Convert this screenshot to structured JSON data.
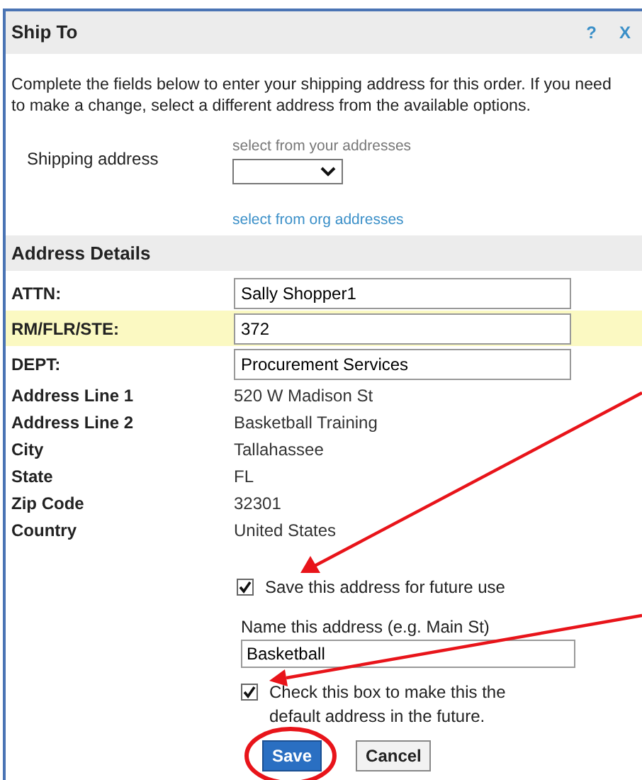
{
  "dialog": {
    "title": "Ship To",
    "help": "?",
    "close": "X"
  },
  "description": "Complete the fields below to enter your shipping address for this order. If you need to make a change, select a different address from the available options.",
  "shipping": {
    "label": "Shipping address",
    "hint": "select from your addresses",
    "link": "select from org addresses"
  },
  "section_title": "Address Details",
  "fields": [
    {
      "label": "ATTN:",
      "value": "Sally Shopper1",
      "kind": "input",
      "highlighted": false
    },
    {
      "label": "RM/FLR/STE:",
      "value": "372",
      "kind": "input",
      "highlighted": true
    },
    {
      "label": "DEPT:",
      "value": "Procurement Services",
      "kind": "input",
      "highlighted": false
    },
    {
      "label": "Address Line 1",
      "value": "520 W Madison St",
      "kind": "text"
    },
    {
      "label": "Address Line 2",
      "value": "Basketball Training",
      "kind": "text"
    },
    {
      "label": "City",
      "value": "Tallahassee",
      "kind": "text"
    },
    {
      "label": "State",
      "value": "FL",
      "kind": "text"
    },
    {
      "label": "Zip Code",
      "value": "32301",
      "kind": "text"
    },
    {
      "label": "Country",
      "value": "United States",
      "kind": "text"
    }
  ],
  "save_address": {
    "label": "Save this address for future use",
    "checked": true
  },
  "name_field": {
    "label": "Name this address (e.g. Main St)",
    "value": "Basketball"
  },
  "default_address": {
    "label": "Check this box to make this the default address in the future.",
    "checked": true
  },
  "buttons": [
    {
      "label": "Save",
      "kind": "primary"
    },
    {
      "label": "Cancel",
      "kind": "secondary"
    }
  ]
}
